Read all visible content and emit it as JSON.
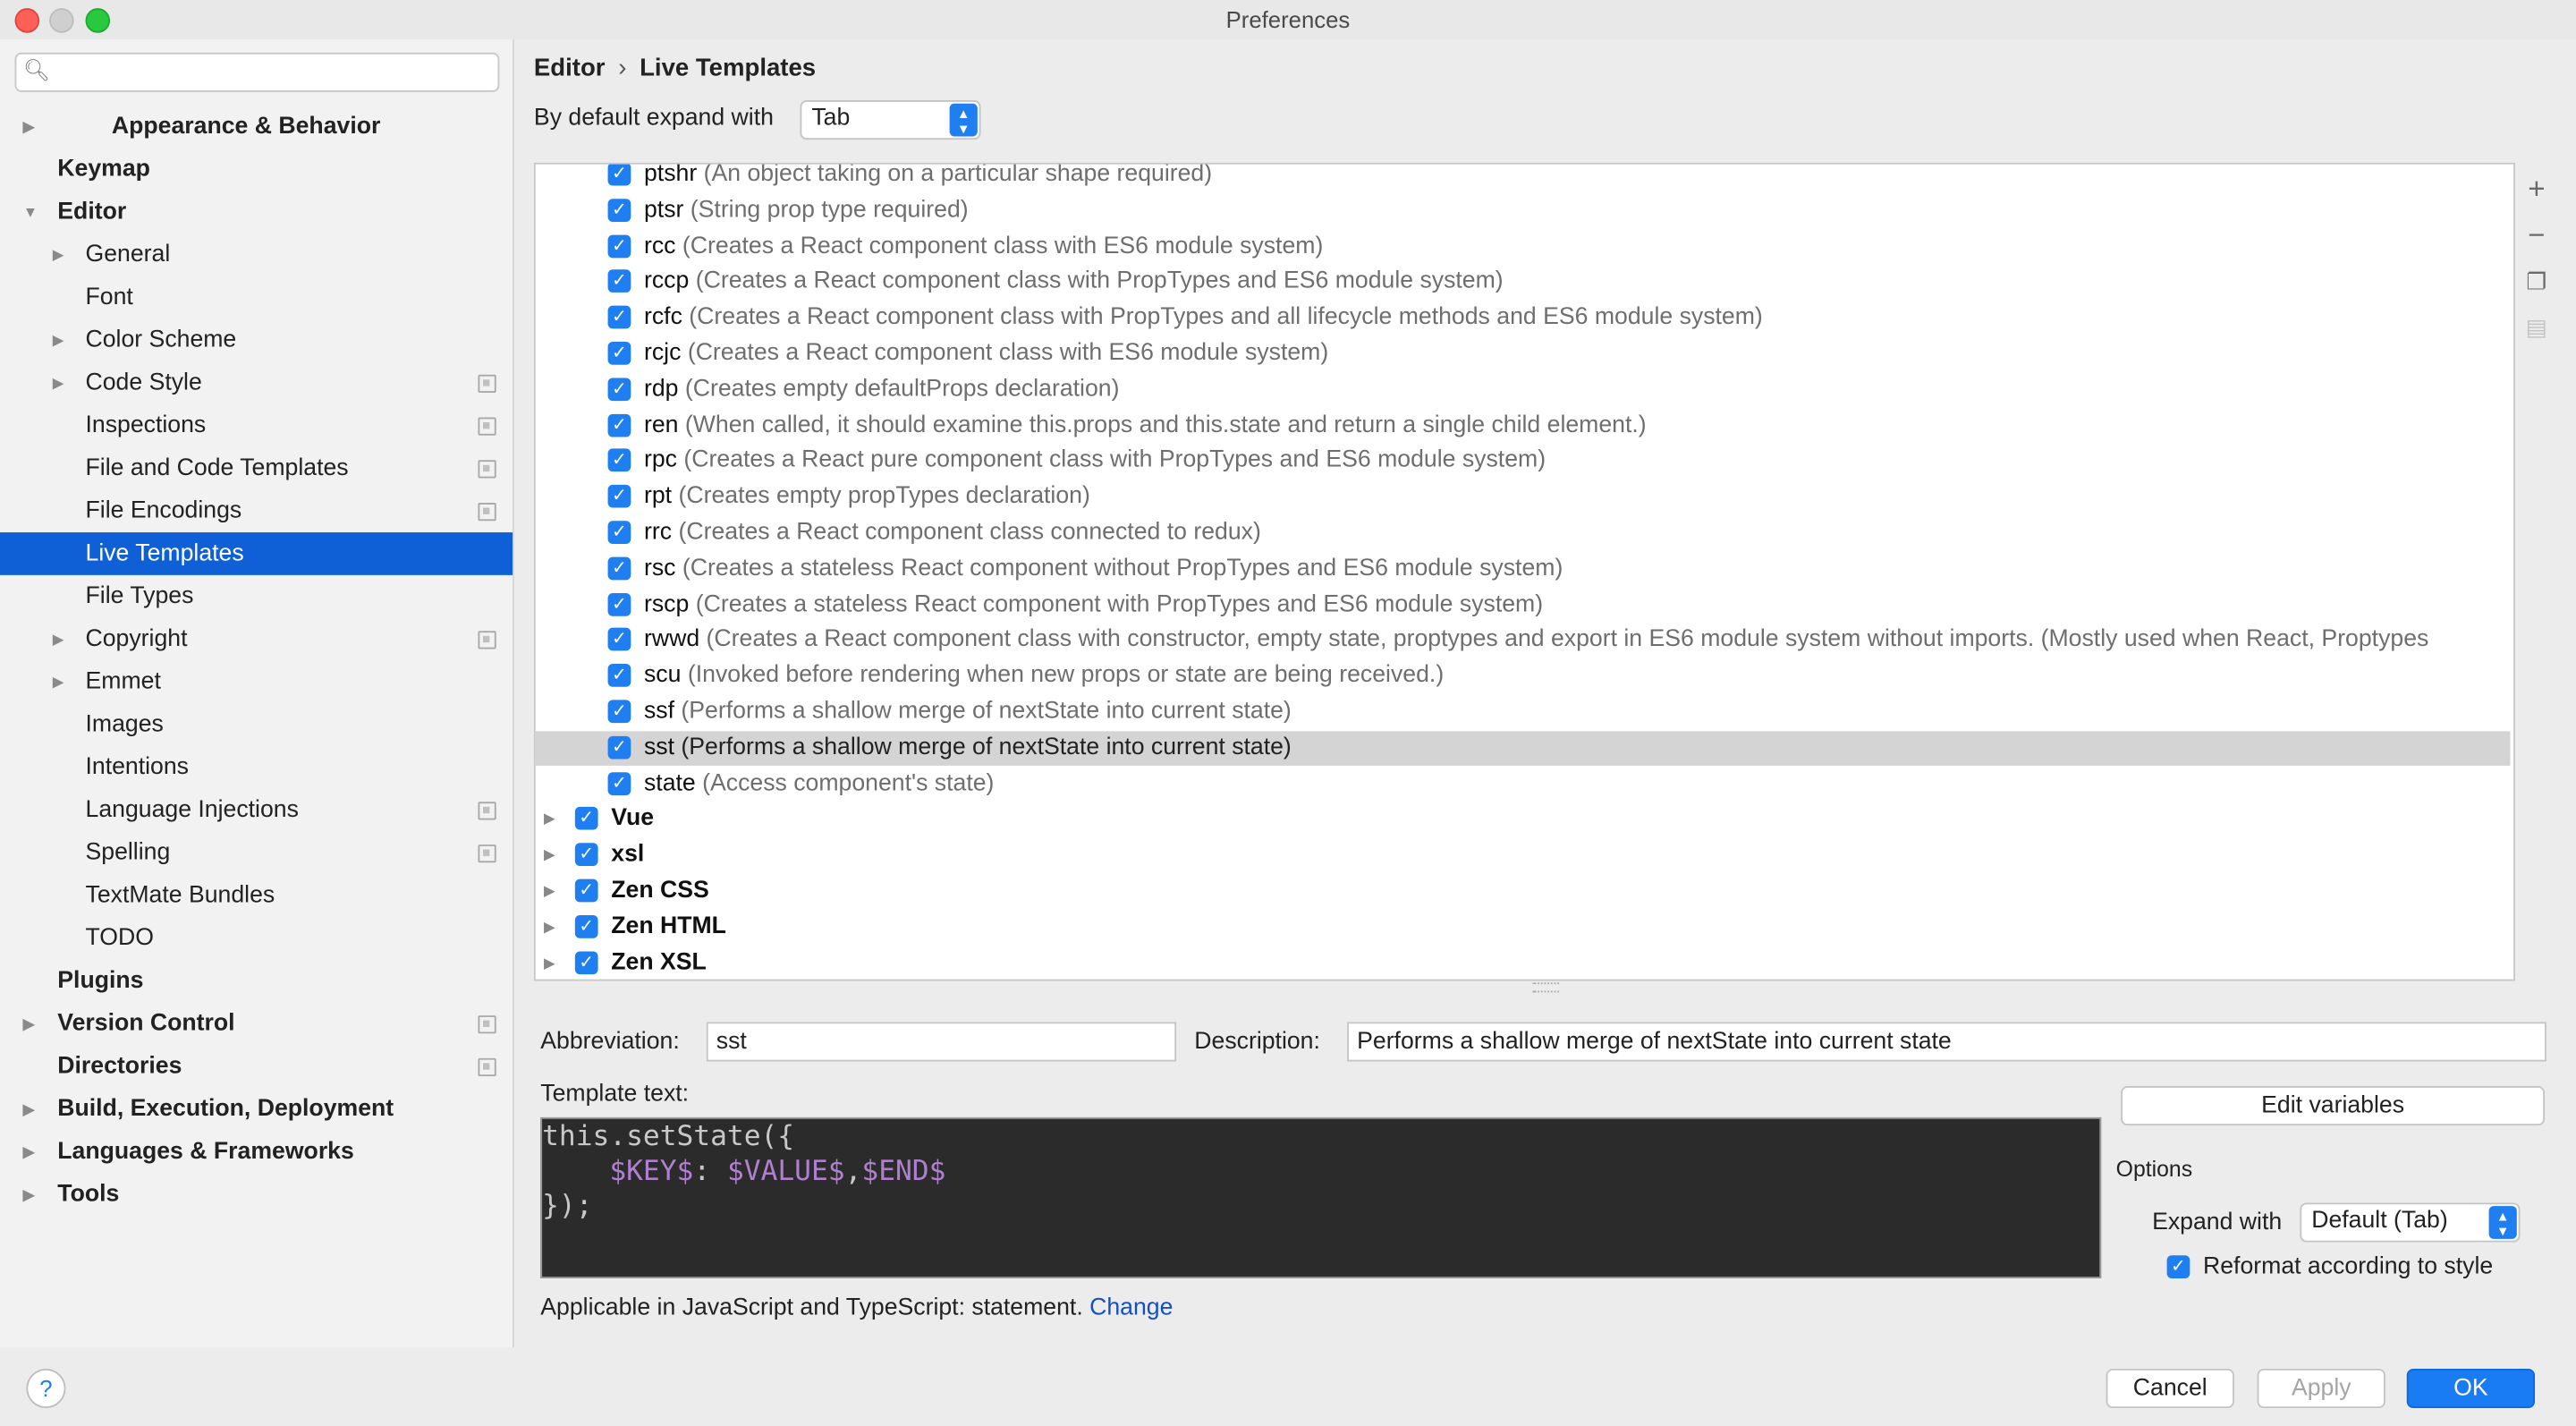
{
  "window": {
    "title": "Preferences"
  },
  "search": {
    "placeholder": ""
  },
  "sidebar": {
    "items": [
      {
        "label": "Appearance & Behavior"
      },
      {
        "label": "Keymap"
      },
      {
        "label": "Editor"
      },
      {
        "label": "General"
      },
      {
        "label": "Font"
      },
      {
        "label": "Color Scheme"
      },
      {
        "label": "Code Style"
      },
      {
        "label": "Inspections"
      },
      {
        "label": "File and Code Templates"
      },
      {
        "label": "File Encodings"
      },
      {
        "label": "Live Templates"
      },
      {
        "label": "File Types"
      },
      {
        "label": "Copyright"
      },
      {
        "label": "Emmet"
      },
      {
        "label": "Images"
      },
      {
        "label": "Intentions"
      },
      {
        "label": "Language Injections"
      },
      {
        "label": "Spelling"
      },
      {
        "label": "TextMate Bundles"
      },
      {
        "label": "TODO"
      },
      {
        "label": "Plugins"
      },
      {
        "label": "Version Control"
      },
      {
        "label": "Directories"
      },
      {
        "label": "Build, Execution, Deployment"
      },
      {
        "label": "Languages & Frameworks"
      },
      {
        "label": "Tools"
      }
    ],
    "selected": "Live Templates"
  },
  "breadcrumb": {
    "parent": "Editor",
    "separator": "›",
    "current": "Live Templates"
  },
  "expand_default": {
    "label": "By default expand with",
    "value": "Tab"
  },
  "templates": [
    {
      "abbr": "ptshr",
      "desc": "(An object taking on a particular shape required)",
      "checked": true
    },
    {
      "abbr": "ptsr",
      "desc": "(String prop type required)",
      "checked": true
    },
    {
      "abbr": "rcc",
      "desc": "(Creates a React component class with ES6 module system)",
      "checked": true
    },
    {
      "abbr": "rccp",
      "desc": "(Creates a React component class with PropTypes and ES6 module system)",
      "checked": true
    },
    {
      "abbr": "rcfc",
      "desc": "(Creates a React component class with PropTypes and all lifecycle methods and ES6 module system)",
      "checked": true
    },
    {
      "abbr": "rcjc",
      "desc": "(Creates a React component class with ES6 module system)",
      "checked": true
    },
    {
      "abbr": "rdp",
      "desc": "(Creates empty defaultProps declaration)",
      "checked": true
    },
    {
      "abbr": "ren",
      "desc": "(When called, it should examine this.props and this.state and return a single child element.)",
      "checked": true
    },
    {
      "abbr": "rpc",
      "desc": "(Creates a React pure component class with PropTypes and ES6 module system)",
      "checked": true
    },
    {
      "abbr": "rpt",
      "desc": "(Creates empty propTypes declaration)",
      "checked": true
    },
    {
      "abbr": "rrc",
      "desc": "(Creates a React component class connected to redux)",
      "checked": true
    },
    {
      "abbr": "rsc",
      "desc": "(Creates a stateless React component without PropTypes and ES6 module system)",
      "checked": true
    },
    {
      "abbr": "rscp",
      "desc": "(Creates a stateless React component with PropTypes and ES6 module system)",
      "checked": true
    },
    {
      "abbr": "rwwd",
      "desc": "(Creates a React component class with constructor, empty state, proptypes and export in ES6 module system without imports. (Mostly used when React, Proptypes",
      "checked": true
    },
    {
      "abbr": "scu",
      "desc": "(Invoked before rendering when new props or state are being received.)",
      "checked": true
    },
    {
      "abbr": "ssf",
      "desc": "(Performs a shallow merge of nextState into current state)",
      "checked": true
    },
    {
      "abbr": "sst",
      "desc": "(Performs a shallow merge of nextState into current state)",
      "checked": true,
      "selected": true
    },
    {
      "abbr": "state",
      "desc": "(Access component's state)",
      "checked": true
    }
  ],
  "groups": [
    {
      "name": "Vue",
      "checked": true
    },
    {
      "name": "xsl",
      "checked": true
    },
    {
      "name": "Zen CSS",
      "checked": true
    },
    {
      "name": "Zen HTML",
      "checked": true
    },
    {
      "name": "Zen XSL",
      "checked": true
    }
  ],
  "detail": {
    "abbreviation_label": "Abbreviation:",
    "abbreviation_value": "sst",
    "description_label": "Description:",
    "description_value": "Performs a shallow merge of nextState into current state",
    "template_text_label": "Template text:",
    "template_lines": [
      "this.setState({",
      "    $KEY$: $VALUE$,$END$",
      "});"
    ],
    "edit_variables": "Edit variables",
    "options_label": "Options",
    "expand_with_label": "Expand with",
    "expand_with_value": "Default (Tab)",
    "reformat_label": "Reformat according to style",
    "reformat_checked": true,
    "applicable_text": "Applicable in JavaScript and TypeScript: statement.",
    "change_link": "Change"
  },
  "footer": {
    "help": "?",
    "cancel": "Cancel",
    "apply": "Apply",
    "ok": "OK"
  },
  "colors": {
    "accent": "#1f7ef0",
    "selection": "#0f5fd6",
    "editor_bg": "#2b2b2b",
    "template_var": "#b07fd0"
  }
}
